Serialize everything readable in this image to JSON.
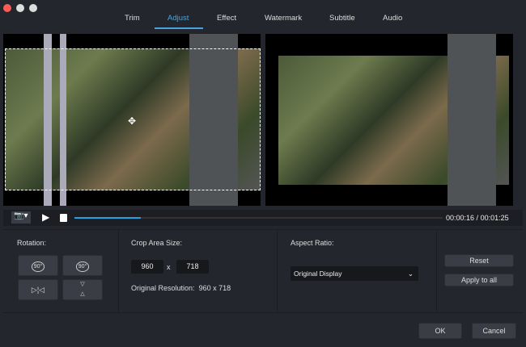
{
  "window": {
    "controls": [
      "close",
      "minimize",
      "maximize"
    ]
  },
  "tabs": [
    {
      "label": "Trim"
    },
    {
      "label": "Adjust",
      "active": true
    },
    {
      "label": "Effect"
    },
    {
      "label": "Watermark"
    },
    {
      "label": "Subtitle"
    },
    {
      "label": "Audio"
    }
  ],
  "player": {
    "current_time": "00:00:16",
    "separator": " / ",
    "total_time": "00:01:25",
    "progress_percent": 18
  },
  "rotation": {
    "label": "Rotation:",
    "rotate_right": "90°",
    "rotate_left": "90°"
  },
  "crop": {
    "label": "Crop Area Size:",
    "width": "960",
    "x": "x",
    "height": "718",
    "original_label": "Original Resolution:",
    "original_value": "960 x 718"
  },
  "aspect": {
    "label": "Aspect Ratio:",
    "selected": "Original Display"
  },
  "actions": {
    "reset": "Reset",
    "apply_all": "Apply to all"
  },
  "footer": {
    "ok": "OK",
    "cancel": "Cancel"
  },
  "colors": {
    "accent": "#1fa3e8",
    "close": "#fc5b57"
  }
}
